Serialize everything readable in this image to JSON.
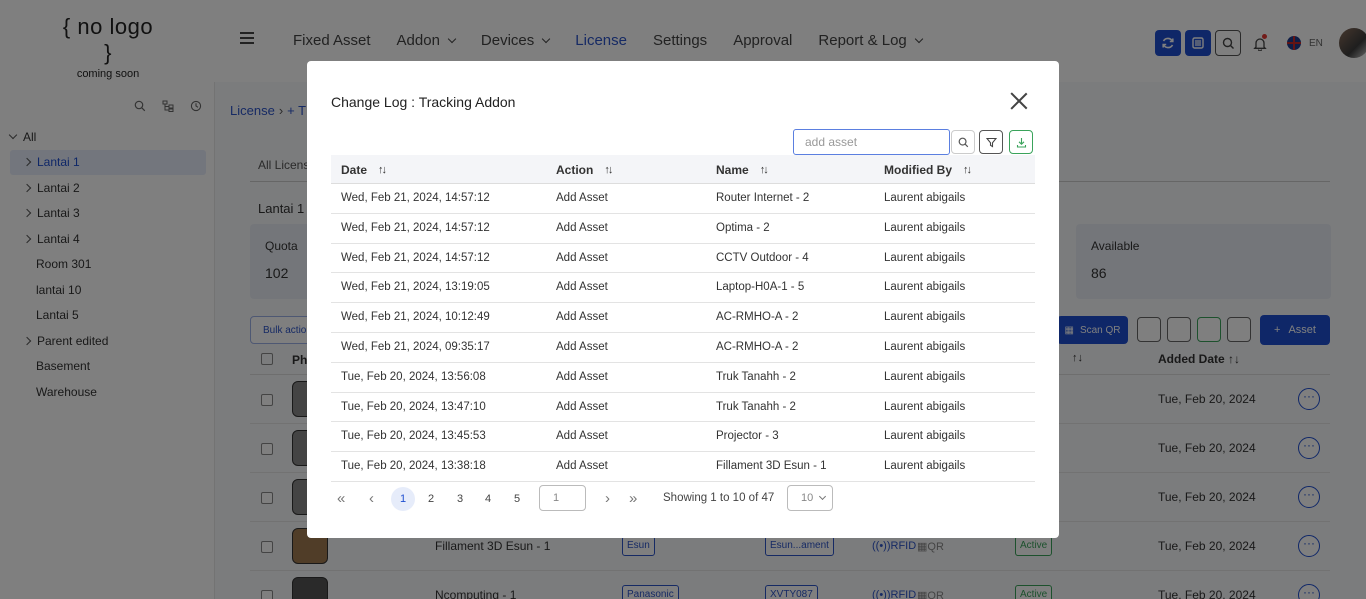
{
  "logo": {
    "main": "{ no logo }",
    "sub": "coming soon"
  },
  "nav": {
    "items": [
      {
        "label": "Fixed Asset",
        "dropdown": false,
        "active": false
      },
      {
        "label": "Addon",
        "dropdown": true,
        "active": false
      },
      {
        "label": "Devices",
        "dropdown": true,
        "active": false
      },
      {
        "label": "License",
        "dropdown": false,
        "active": true
      },
      {
        "label": "Settings",
        "dropdown": false,
        "active": false
      },
      {
        "label": "Approval",
        "dropdown": false,
        "active": false
      },
      {
        "label": "Report & Log",
        "dropdown": true,
        "active": false
      }
    ],
    "lang": "EN"
  },
  "sidebar": {
    "root": "All",
    "items": [
      {
        "label": "Lantai 1",
        "expandable": true,
        "selected": true
      },
      {
        "label": "Lantai 2",
        "expandable": true,
        "selected": false
      },
      {
        "label": "Lantai 3",
        "expandable": true,
        "selected": false
      },
      {
        "label": "Lantai 4",
        "expandable": true,
        "selected": false
      },
      {
        "label": "Room 301",
        "expandable": false,
        "selected": false
      },
      {
        "label": "lantai 10",
        "expandable": false,
        "selected": false
      },
      {
        "label": "Lantai 5",
        "expandable": false,
        "selected": false
      },
      {
        "label": "Parent edited",
        "expandable": true,
        "selected": false
      },
      {
        "label": "Basement",
        "expandable": false,
        "selected": false
      },
      {
        "label": "Warehouse",
        "expandable": false,
        "selected": false
      }
    ]
  },
  "background": {
    "breadcrumb": {
      "first": "License",
      "second": "T"
    },
    "tab": "All Licens",
    "section_title": "Lantai 1",
    "quota": {
      "label": "Quota",
      "value": "102"
    },
    "available": {
      "label": "Available",
      "value": "86"
    },
    "bulk_label": "Bulk action",
    "scan_label": "Scan QR",
    "asset_label": "Asset",
    "photo_header": "Pho",
    "added_header": "Added Date",
    "rows": [
      {
        "name": "",
        "brand": "",
        "model": "",
        "rfid": "",
        "qr": "",
        "status": "",
        "date": "Tue, Feb 20, 2024"
      },
      {
        "name": "",
        "brand": "",
        "model": "",
        "rfid": "",
        "qr": "",
        "status": "",
        "date": "Tue, Feb 20, 2024"
      },
      {
        "name": "",
        "brand": "",
        "model": "",
        "rfid": "",
        "qr": "",
        "status": "",
        "date": "Tue, Feb 20, 2024"
      },
      {
        "name": "Fillament 3D Esun - 1",
        "brand": "Esun",
        "model": "Esun...ament",
        "rfid": "RFID",
        "qr": "QR",
        "status": "Active",
        "date": "Tue, Feb 20, 2024"
      },
      {
        "name": "Ncomputing - 1",
        "brand": "Panasonic",
        "model": "XVTY087",
        "rfid": "RFID",
        "qr": "QR",
        "status": "Active",
        "date": "Tue, Feb 20, 2024"
      }
    ]
  },
  "modal": {
    "title": "Change Log : Tracking Addon",
    "search_placeholder": "add asset",
    "columns": [
      "Date",
      "Action",
      "Name",
      "Modified By"
    ],
    "rows": [
      {
        "date": "Wed, Feb 21, 2024, 14:57:12",
        "action": "Add Asset",
        "name": "Router Internet - 2",
        "modified_by": "Laurent abigails"
      },
      {
        "date": "Wed, Feb 21, 2024, 14:57:12",
        "action": "Add Asset",
        "name": "Optima - 2",
        "modified_by": "Laurent abigails"
      },
      {
        "date": "Wed, Feb 21, 2024, 14:57:12",
        "action": "Add Asset",
        "name": "CCTV Outdoor - 4",
        "modified_by": "Laurent abigails"
      },
      {
        "date": "Wed, Feb 21, 2024, 13:19:05",
        "action": "Add Asset",
        "name": "Laptop-H0A-1 - 5",
        "modified_by": "Laurent abigails"
      },
      {
        "date": "Wed, Feb 21, 2024, 10:12:49",
        "action": "Add Asset",
        "name": "AC-RMHO-A - 2",
        "modified_by": "Laurent abigails"
      },
      {
        "date": "Wed, Feb 21, 2024, 09:35:17",
        "action": "Add Asset",
        "name": "AC-RMHO-A - 2",
        "modified_by": "Laurent abigails"
      },
      {
        "date": "Tue, Feb 20, 2024, 13:56:08",
        "action": "Add Asset",
        "name": "Truk Tanahh - 2",
        "modified_by": "Laurent abigails"
      },
      {
        "date": "Tue, Feb 20, 2024, 13:47:10",
        "action": "Add Asset",
        "name": "Truk Tanahh - 2",
        "modified_by": "Laurent abigails"
      },
      {
        "date": "Tue, Feb 20, 2024, 13:45:53",
        "action": "Add Asset",
        "name": "Projector - 3",
        "modified_by": "Laurent abigails"
      },
      {
        "date": "Tue, Feb 20, 2024, 13:38:18",
        "action": "Add Asset",
        "name": "Fillament 3D Esun - 1",
        "modified_by": "Laurent abigails"
      }
    ],
    "pagination": {
      "pages": [
        "1",
        "2",
        "3",
        "4",
        "5"
      ],
      "current": "1",
      "goto_value": "1",
      "showing": "Showing 1 to 10 of 47",
      "page_size": "10"
    }
  },
  "colors": {
    "accent": "#1f4fd1",
    "success": "#3aa35b",
    "overlay": "rgba(0,0,0,0.5)"
  }
}
